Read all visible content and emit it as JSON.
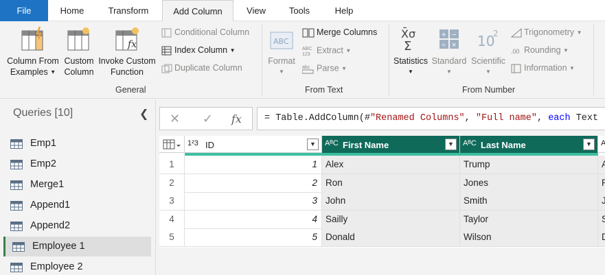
{
  "tabs": [
    {
      "label": "File"
    },
    {
      "label": "Home"
    },
    {
      "label": "Transform"
    },
    {
      "label": "Add Column"
    },
    {
      "label": "View"
    },
    {
      "label": "Tools"
    },
    {
      "label": "Help"
    }
  ],
  "ribbon": {
    "general": {
      "col_from_examples_1": "Column From",
      "col_from_examples_2": "Examples",
      "custom_col_1": "Custom",
      "custom_col_2": "Column",
      "invoke_1": "Invoke Custom",
      "invoke_2": "Function",
      "conditional": "Conditional Column",
      "index": "Index Column",
      "duplicate": "Duplicate Column",
      "label": "General"
    },
    "from_text": {
      "format": "Format",
      "merge": "Merge Columns",
      "extract": "Extract",
      "parse": "Parse",
      "label": "From Text"
    },
    "from_number": {
      "statistics": "Statistics",
      "standard": "Standard",
      "scientific": "Scientific",
      "trigonometry": "Trigonometry",
      "rounding": "Rounding",
      "information": "Information",
      "label": "From Number"
    }
  },
  "queries": {
    "title": "Queries [10]",
    "items": [
      {
        "label": "Emp1"
      },
      {
        "label": "Emp2"
      },
      {
        "label": "Merge1"
      },
      {
        "label": "Append1"
      },
      {
        "label": "Append2"
      },
      {
        "label": "Employee 1"
      },
      {
        "label": "Employee 2"
      }
    ]
  },
  "formula": {
    "prefix": "= Table.AddColumn(#",
    "arg1": "\"Renamed Columns\"",
    "comma": ", ",
    "arg2": "\"Full name\"",
    "each": "each",
    "rest": " Text"
  },
  "grid": {
    "columns": [
      {
        "type": "1²3",
        "name": "ID"
      },
      {
        "type": "AᴮC",
        "name": "First Name"
      },
      {
        "type": "AᴮC",
        "name": "Last Name"
      },
      {
        "type": "A",
        "name": ""
      }
    ],
    "rows": [
      {
        "n": "1",
        "id": "1",
        "first": "Alex",
        "last": "Trump",
        "extra": "A"
      },
      {
        "n": "2",
        "id": "2",
        "first": "Ron",
        "last": "Jones",
        "extra": "R"
      },
      {
        "n": "3",
        "id": "3",
        "first": "John",
        "last": "Smith",
        "extra": "J"
      },
      {
        "n": "4",
        "id": "4",
        "first": "Sailly",
        "last": "Taylor",
        "extra": "S"
      },
      {
        "n": "5",
        "id": "5",
        "first": "Donald",
        "last": "Wilson",
        "extra": "D"
      }
    ]
  },
  "colors": {
    "file_tab": "#1e73c4",
    "header_teal": "#0f6a5a",
    "accent_teal": "#3fbf9f",
    "selected_query_bar": "#3a7f4a"
  }
}
